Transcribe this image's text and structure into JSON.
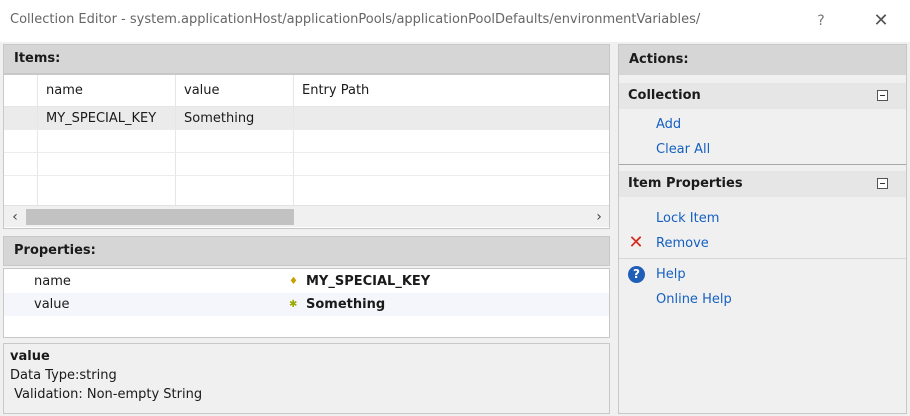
{
  "window": {
    "title": "Collection Editor - system.applicationHost/applicationPools/applicationPoolDefaults/environmentVariables/",
    "help_glyph": "?",
    "close_glyph": "✕"
  },
  "items": {
    "header": "Items:",
    "columns": [
      "name",
      "value",
      "Entry Path"
    ],
    "rows": [
      {
        "name": "MY_SPECIAL_KEY",
        "value": "Something",
        "entry_path": ""
      }
    ],
    "scroll_left": "‹",
    "scroll_right": "›"
  },
  "properties": {
    "header": "Properties:",
    "rows": [
      {
        "name": "name",
        "value": "MY_SPECIAL_KEY",
        "icon": "key-icon",
        "icon_glyph": "♦"
      },
      {
        "name": "value",
        "value": "Something",
        "icon": "required-star-icon",
        "icon_glyph": "✱"
      }
    ]
  },
  "description": {
    "title": "value",
    "lines": [
      "Data Type:string",
      " Validation: Non-empty String"
    ]
  },
  "actions": {
    "header": "Actions:",
    "groups": [
      {
        "title": "Collection",
        "items": [
          {
            "label": "Add"
          },
          {
            "label": "Clear All"
          }
        ]
      },
      {
        "title": "Item Properties",
        "items": [
          {
            "label": "Lock Item"
          },
          {
            "label": "Remove",
            "icon": "remove-icon",
            "icon_glyph": "✕"
          },
          {
            "label": "Help",
            "icon": "help-icon",
            "icon_glyph": "?"
          },
          {
            "label": "Online Help"
          }
        ]
      }
    ]
  },
  "colors": {
    "link": "#1560c0",
    "header_bg": "#d6d6d6",
    "remove_red": "#d42a1e",
    "help_blue": "#1f5fb8"
  }
}
